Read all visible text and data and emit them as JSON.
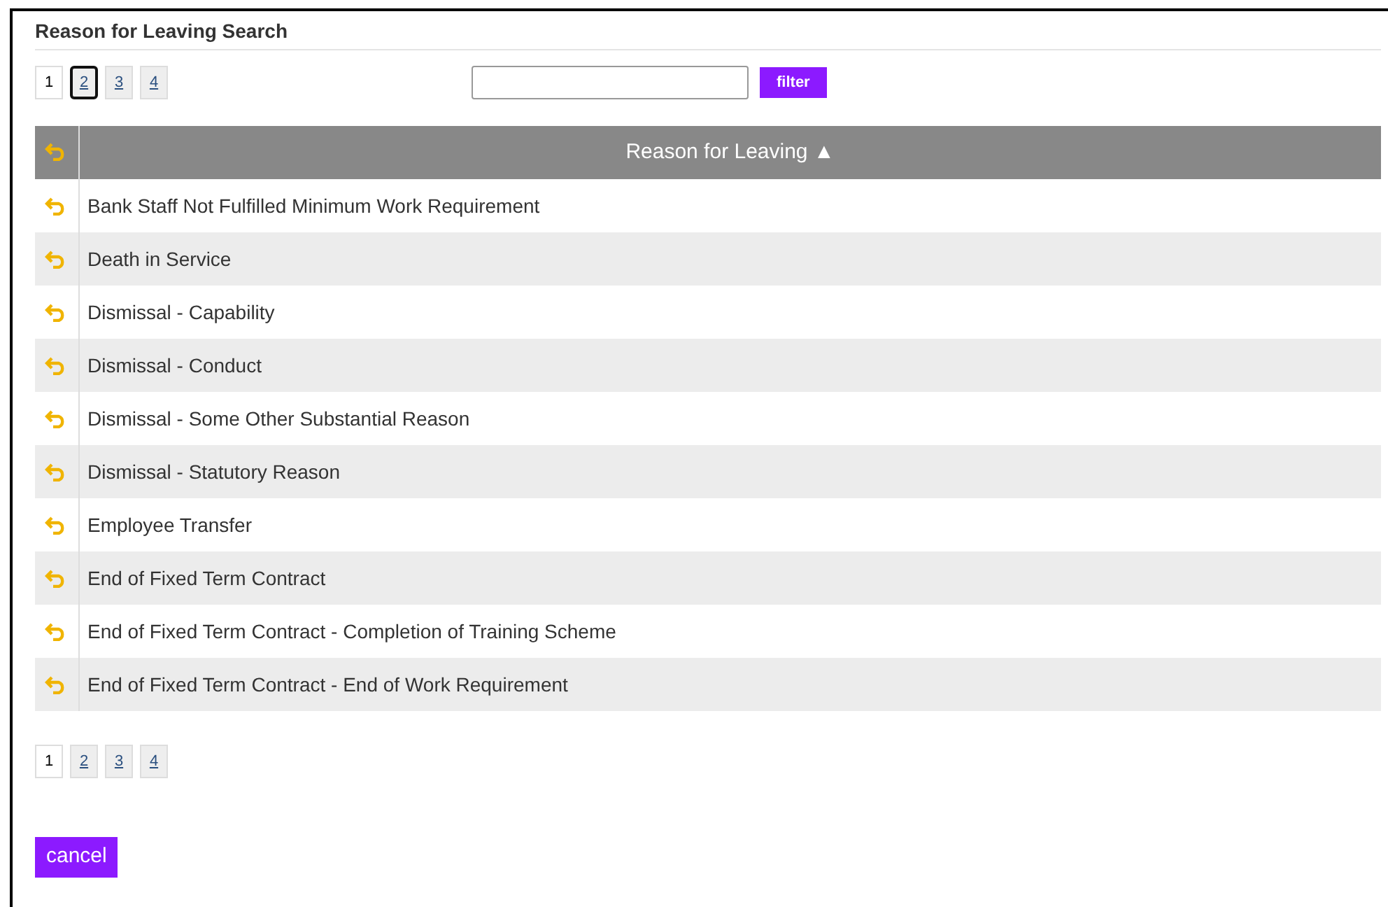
{
  "title": "Reason for Leaving Search",
  "pager_top": [
    {
      "label": "1",
      "selected": true,
      "focused": false
    },
    {
      "label": "2",
      "selected": false,
      "focused": true
    },
    {
      "label": "3",
      "selected": false,
      "focused": false
    },
    {
      "label": "4",
      "selected": false,
      "focused": false
    }
  ],
  "filter": {
    "button": "filter"
  },
  "table": {
    "columns": [
      {
        "label": "Reason for Leaving",
        "sort_icon": "▲"
      }
    ],
    "rows": [
      {
        "cell": "Bank Staff Not Fulfilled Minimum Work Requirement"
      },
      {
        "cell": "Death in Service"
      },
      {
        "cell": "Dismissal - Capability"
      },
      {
        "cell": "Dismissal - Conduct"
      },
      {
        "cell": "Dismissal - Some Other Substantial Reason"
      },
      {
        "cell": "Dismissal - Statutory Reason"
      },
      {
        "cell": "Employee Transfer"
      },
      {
        "cell": "End of Fixed Term Contract"
      },
      {
        "cell": "End of Fixed Term Contract - Completion of Training Scheme"
      },
      {
        "cell": "End of Fixed Term Contract - End of Work Requirement"
      }
    ]
  },
  "pager_bottom": [
    {
      "label": "1",
      "selected": true,
      "focused": false
    },
    {
      "label": "2",
      "selected": false,
      "focused": false
    },
    {
      "label": "3",
      "selected": false,
      "focused": false
    },
    {
      "label": "4",
      "selected": false,
      "focused": false
    }
  ],
  "cancel": "cancel"
}
